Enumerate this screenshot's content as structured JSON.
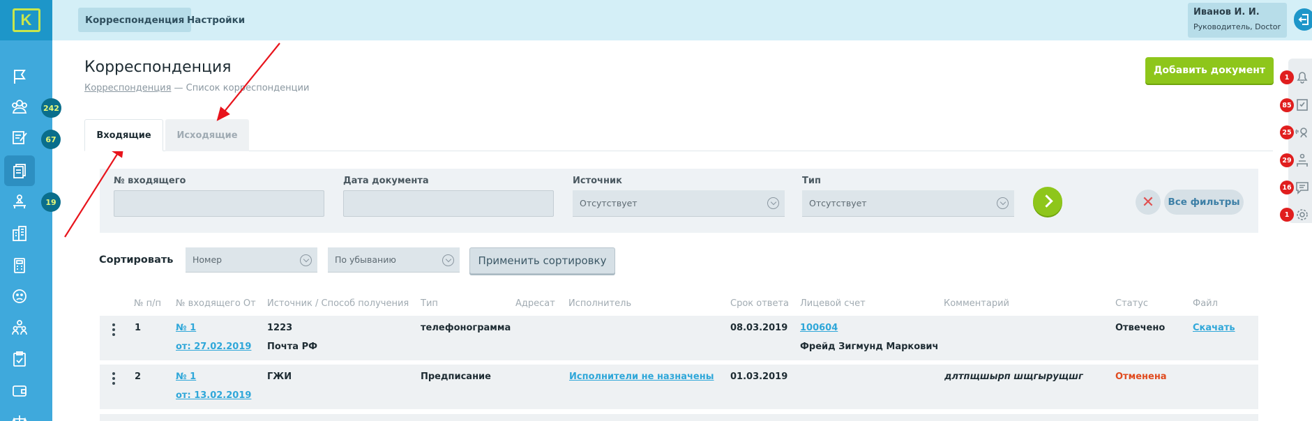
{
  "app": {
    "logo_letter": "K"
  },
  "sidebar": {
    "badges": [
      {
        "item": "clients",
        "count": "242"
      },
      {
        "item": "tasks",
        "count": "67"
      },
      {
        "item": "ofice",
        "count": "19"
      }
    ]
  },
  "topbar": {
    "tabs": [
      {
        "label": "Корреспонденция",
        "active": true
      },
      {
        "label": "Настройки",
        "active": false
      }
    ],
    "user": {
      "name": "Иванов И. И.",
      "role": "Руководитель, Doctor"
    }
  },
  "rail_badges": [
    "1",
    "85",
    "25",
    "29",
    "16",
    "1"
  ],
  "page": {
    "title": "Корреспонденция",
    "breadcrumb_link": "Корреспонденция",
    "breadcrumb_current": "— Список корреспонденции",
    "add_button": "Добавить документ"
  },
  "tabs": {
    "incoming": "Входящие",
    "outgoing": "Исходящие"
  },
  "filters": {
    "incoming_no_label": "№ входящего",
    "doc_date_label": "Дата документа",
    "source_label": "Источник",
    "source_value": "Отсутствует",
    "type_label": "Тип",
    "type_value": "Отсутствует",
    "all_filters": "Все фильтры",
    "clear": "✕"
  },
  "sort": {
    "label": "Сортировать",
    "field_value": "Номер",
    "order_value": "По убыванию",
    "apply": "Применить сортировку"
  },
  "table": {
    "headers": [
      "№ п/п",
      "№ входящего От",
      "Источник / Способ получения",
      "Тип",
      "Адресат",
      "Исполнитель",
      "Срок ответа",
      "Лицевой счет",
      "Комментарий",
      "Статус",
      "Файл"
    ],
    "rows": [
      {
        "n": "1",
        "no": "№ 1",
        "from": "от: 27.02.2019",
        "source": "1223",
        "method": "Почта РФ",
        "type": "телефонограмма",
        "executor": "",
        "deadline": "08.03.2019",
        "account": "100604",
        "account_owner": "Фрейд Зигмунд Маркович",
        "comment": "",
        "status": "Отвечено",
        "file": "Скачать"
      },
      {
        "n": "2",
        "no": "№ 1",
        "from": "от: 13.02.2019",
        "source": "ГЖИ",
        "method": "",
        "type": "Предписание",
        "executor": "Исполнители не назначены",
        "deadline": "01.03.2019",
        "account": "",
        "account_owner": "",
        "comment": "длтпщшырп шщгырущшг",
        "status": "Отменена",
        "file": ""
      }
    ]
  },
  "colors": {
    "sidebar": "#3fa9dc",
    "accent_green": "#8ec61b",
    "badge_red": "#e01e1e",
    "link": "#2fa7d9",
    "annotation": "#e8141c"
  }
}
